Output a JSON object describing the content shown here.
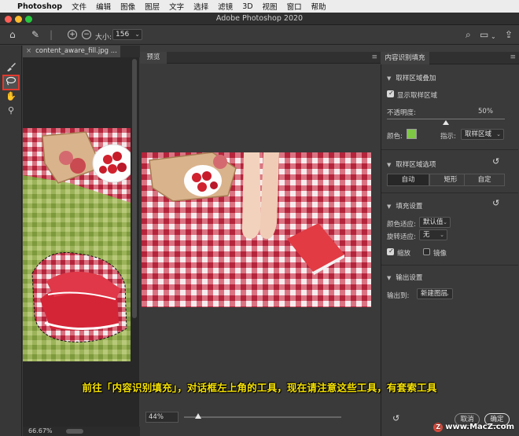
{
  "menubar": {
    "app_name": "Photoshop",
    "items": [
      "文件",
      "编辑",
      "图像",
      "图层",
      "文字",
      "选择",
      "滤镜",
      "3D",
      "视图",
      "窗口",
      "帮助"
    ]
  },
  "window": {
    "title": "Adobe Photoshop 2020"
  },
  "options_bar": {
    "size_label": "大小:",
    "size_value": "156"
  },
  "document": {
    "tab_label": "content_aware_fill.jpg ...",
    "zoom": "66.67%"
  },
  "preview": {
    "tab_label": "预览",
    "zoom": "44%"
  },
  "panel": {
    "title": "内容识别填充",
    "sampling_overlay": {
      "title": "取样区域叠加",
      "show_label": "显示取样区域",
      "show_checked": true,
      "opacity_label": "不透明度:",
      "opacity_value": "50%",
      "color_label": "颜色:",
      "color_swatch": "#7ec845",
      "indicate_label": "指示:",
      "indicate_value": "取样区域"
    },
    "sampling_options": {
      "title": "取样区域选项",
      "modes": [
        "自动",
        "矩形",
        "自定"
      ],
      "active_mode": "自动"
    },
    "fill_settings": {
      "title": "填充设置",
      "color_adapt_label": "颜色适应:",
      "color_adapt_value": "默认值",
      "rotation_adapt_label": "旋转适应:",
      "rotation_adapt_value": "无",
      "scale_label": "缩放",
      "scale_checked": true,
      "mirror_label": "镜像",
      "mirror_checked": false
    },
    "output": {
      "title": "输出设置",
      "output_label": "输出到:",
      "output_value": "新建图层"
    },
    "cancel_label": "取消",
    "ok_label": "确定"
  },
  "caption": "前往「内容识别填充」，对话框左上角的工具，现在请注意这些工具，有套索工具",
  "watermark": "www.MacZ.com",
  "colors": {
    "highlight": "#e03a2e",
    "caption": "#f6e200"
  }
}
